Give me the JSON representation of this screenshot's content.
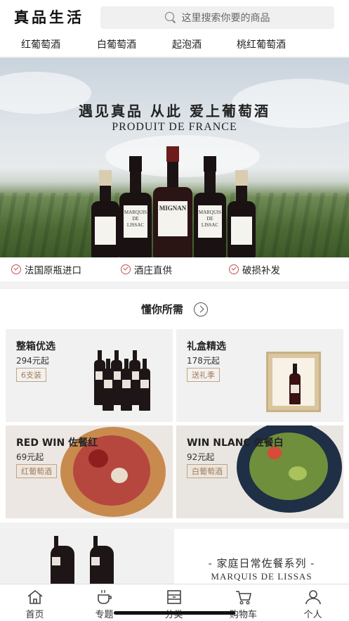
{
  "header": {
    "logo_text": "真品生活",
    "search_placeholder": "这里搜索你要的商品"
  },
  "tabs": [
    "红葡萄酒",
    "白葡萄酒",
    "起泡酒",
    "桃红葡萄酒"
  ],
  "banner": {
    "title": "遇见真品  从此 爱上葡萄酒",
    "subtitle": "PRODUIT DE FRANCE",
    "labels": [
      "MARQUIS DE LISSAC",
      "MIGNAN",
      "MARQUIS DE LISSAC"
    ]
  },
  "features": [
    "法国原瓶进口",
    "酒庄直供",
    "破损补发"
  ],
  "section": {
    "title": "懂你所需",
    "cards": [
      {
        "title": "整箱优选",
        "price": "294元起",
        "tag": "6支装"
      },
      {
        "title": "礼盒精选",
        "price": "178元起",
        "tag": "送礼季"
      },
      {
        "title": "RED WIN 佐餐红",
        "price": "69元起",
        "tag": "红葡萄酒"
      },
      {
        "title": "WIN NLANC 佐餐白",
        "price": "92元起",
        "tag": "白葡萄酒"
      }
    ]
  },
  "promo": {
    "title": "- 家庭日常佐餐系列 -",
    "subtitle": "MARQUIS DE LISSAS"
  },
  "nav": [
    {
      "label": "首页",
      "icon": "home-icon"
    },
    {
      "label": "专题",
      "icon": "cup-icon"
    },
    {
      "label": "分类",
      "icon": "category-icon"
    },
    {
      "label": "购物车",
      "icon": "cart-icon"
    },
    {
      "label": "个人",
      "icon": "user-icon"
    }
  ]
}
